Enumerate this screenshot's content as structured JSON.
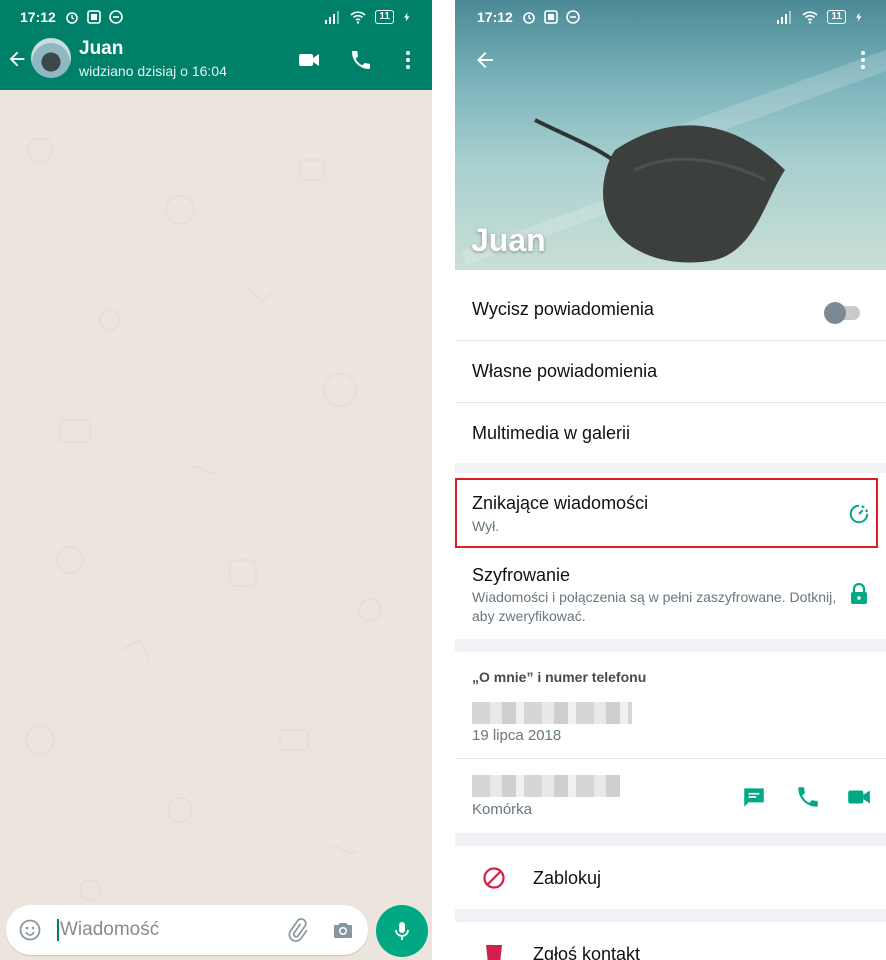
{
  "status_bar": {
    "time": "17:12",
    "battery": "11"
  },
  "chat": {
    "contact_name": "Juan",
    "contact_status": "widziano dzisiaj o 16:04",
    "composer_placeholder": "Wiadomość"
  },
  "profile": {
    "name": "Juan",
    "rows": {
      "mute": "Wycisz powiadomienia",
      "custom_notifications": "Własne powiadomienia",
      "media": "Multimedia w galerii",
      "disappearing_title": "Znikające wiadomości",
      "disappearing_value": "Wył.",
      "encryption_title": "Szyfrowanie",
      "encryption_sub": "Wiadomości i połączenia są w pełni zaszyfrowane. Dotknij, aby zweryfikować."
    },
    "about_section_label": "„O mnie” i numer telefonu",
    "about_date": "19 lipca 2018",
    "phone_type": "Komórka",
    "block_label": "Zablokuj",
    "report_label": "Zgłoś kontakt",
    "mute_enabled": false
  },
  "colors": {
    "header_green": "#008069",
    "accent_green": "#00a884",
    "danger_red": "#d1204a",
    "highlight_red": "#e01c24"
  },
  "icons": [
    "back-arrow-icon",
    "video-call-icon",
    "phone-icon",
    "more-vertical-icon",
    "emoji-icon",
    "attach-icon",
    "camera-icon",
    "mic-icon",
    "timer-icon",
    "lock-icon",
    "message-icon",
    "block-icon",
    "report-icon"
  ]
}
